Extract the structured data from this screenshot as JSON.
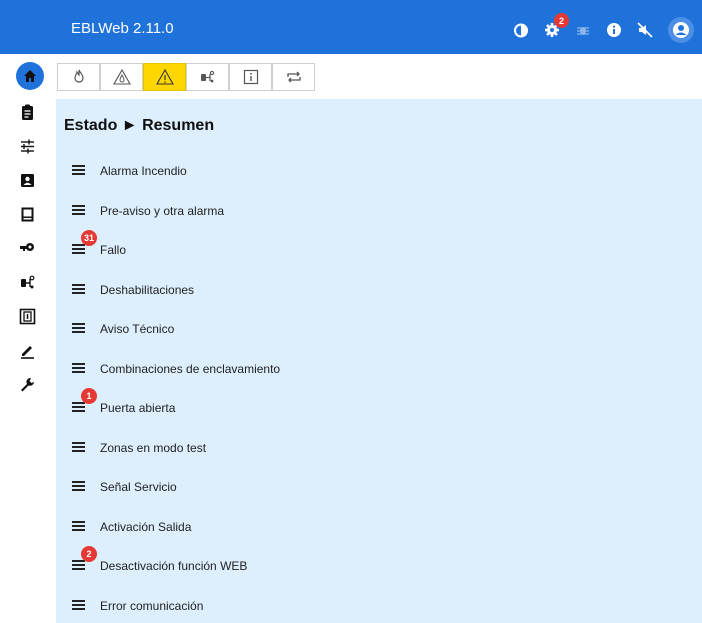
{
  "app": {
    "title": "EBLWeb 2.11.0"
  },
  "topbar": {
    "icons": [
      {
        "name": "drop-icon"
      },
      {
        "name": "gear-icon",
        "badge": "2"
      },
      {
        "name": "bug-icon"
      },
      {
        "name": "info-icon"
      },
      {
        "name": "mute-icon"
      },
      {
        "name": "user-icon"
      }
    ]
  },
  "sidebar": {
    "items": [
      {
        "name": "home-icon",
        "active": true
      },
      {
        "name": "clipboard-icon"
      },
      {
        "name": "sliders-icon"
      },
      {
        "name": "contact-card-icon"
      },
      {
        "name": "panel-icon"
      },
      {
        "name": "key-icon"
      },
      {
        "name": "network-icon"
      },
      {
        "name": "io-module-icon"
      },
      {
        "name": "pencil-icon"
      },
      {
        "name": "wrench-icon"
      }
    ]
  },
  "tabs": [
    {
      "name": "fire-icon"
    },
    {
      "name": "pre-alarm-icon"
    },
    {
      "name": "warning-icon",
      "active": true
    },
    {
      "name": "network-icon"
    },
    {
      "name": "info-icon"
    },
    {
      "name": "repeat-icon"
    }
  ],
  "breadcrumb": {
    "text": "Estado ► Resumen"
  },
  "status_list": {
    "items": [
      {
        "label": "Alarma Incendio",
        "badge": ""
      },
      {
        "label": "Pre-aviso y otra alarma",
        "badge": ""
      },
      {
        "label": "Fallo",
        "badge": "31"
      },
      {
        "label": "Deshabilitaciones",
        "badge": ""
      },
      {
        "label": "Aviso Técnico",
        "badge": ""
      },
      {
        "label": "Combinaciones de enclavamiento",
        "badge": ""
      },
      {
        "label": "Puerta abierta",
        "badge": "1"
      },
      {
        "label": "Zonas en modo test",
        "badge": ""
      },
      {
        "label": "Señal Servicio",
        "badge": ""
      },
      {
        "label": "Activación Salida",
        "badge": ""
      },
      {
        "label": "Desactivación función WEB",
        "badge": "2"
      },
      {
        "label": "Error comunicación",
        "badge": ""
      }
    ]
  },
  "colors": {
    "topbar": "#1f72d9",
    "panel": "#ddeffd",
    "active_tab": "#ffd700",
    "badge": "#e53935"
  }
}
